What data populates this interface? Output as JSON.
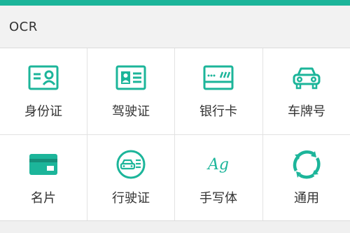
{
  "header": {
    "title": "OCR"
  },
  "items": [
    {
      "label": "身份证",
      "icon": "id-card-icon"
    },
    {
      "label": "驾驶证",
      "icon": "driver-license-icon"
    },
    {
      "label": "银行卡",
      "icon": "bank-card-icon"
    },
    {
      "label": "车牌号",
      "icon": "car-plate-icon"
    },
    {
      "label": "名片",
      "icon": "business-card-icon"
    },
    {
      "label": "行驶证",
      "icon": "vehicle-license-icon"
    },
    {
      "label": "手写体",
      "icon": "handwriting-icon",
      "glyph": "Ag"
    },
    {
      "label": "通用",
      "icon": "general-refresh-icon"
    }
  ],
  "colors": {
    "accent": "#1cb59a",
    "text": "#333333",
    "background": "#f5f5f5"
  }
}
